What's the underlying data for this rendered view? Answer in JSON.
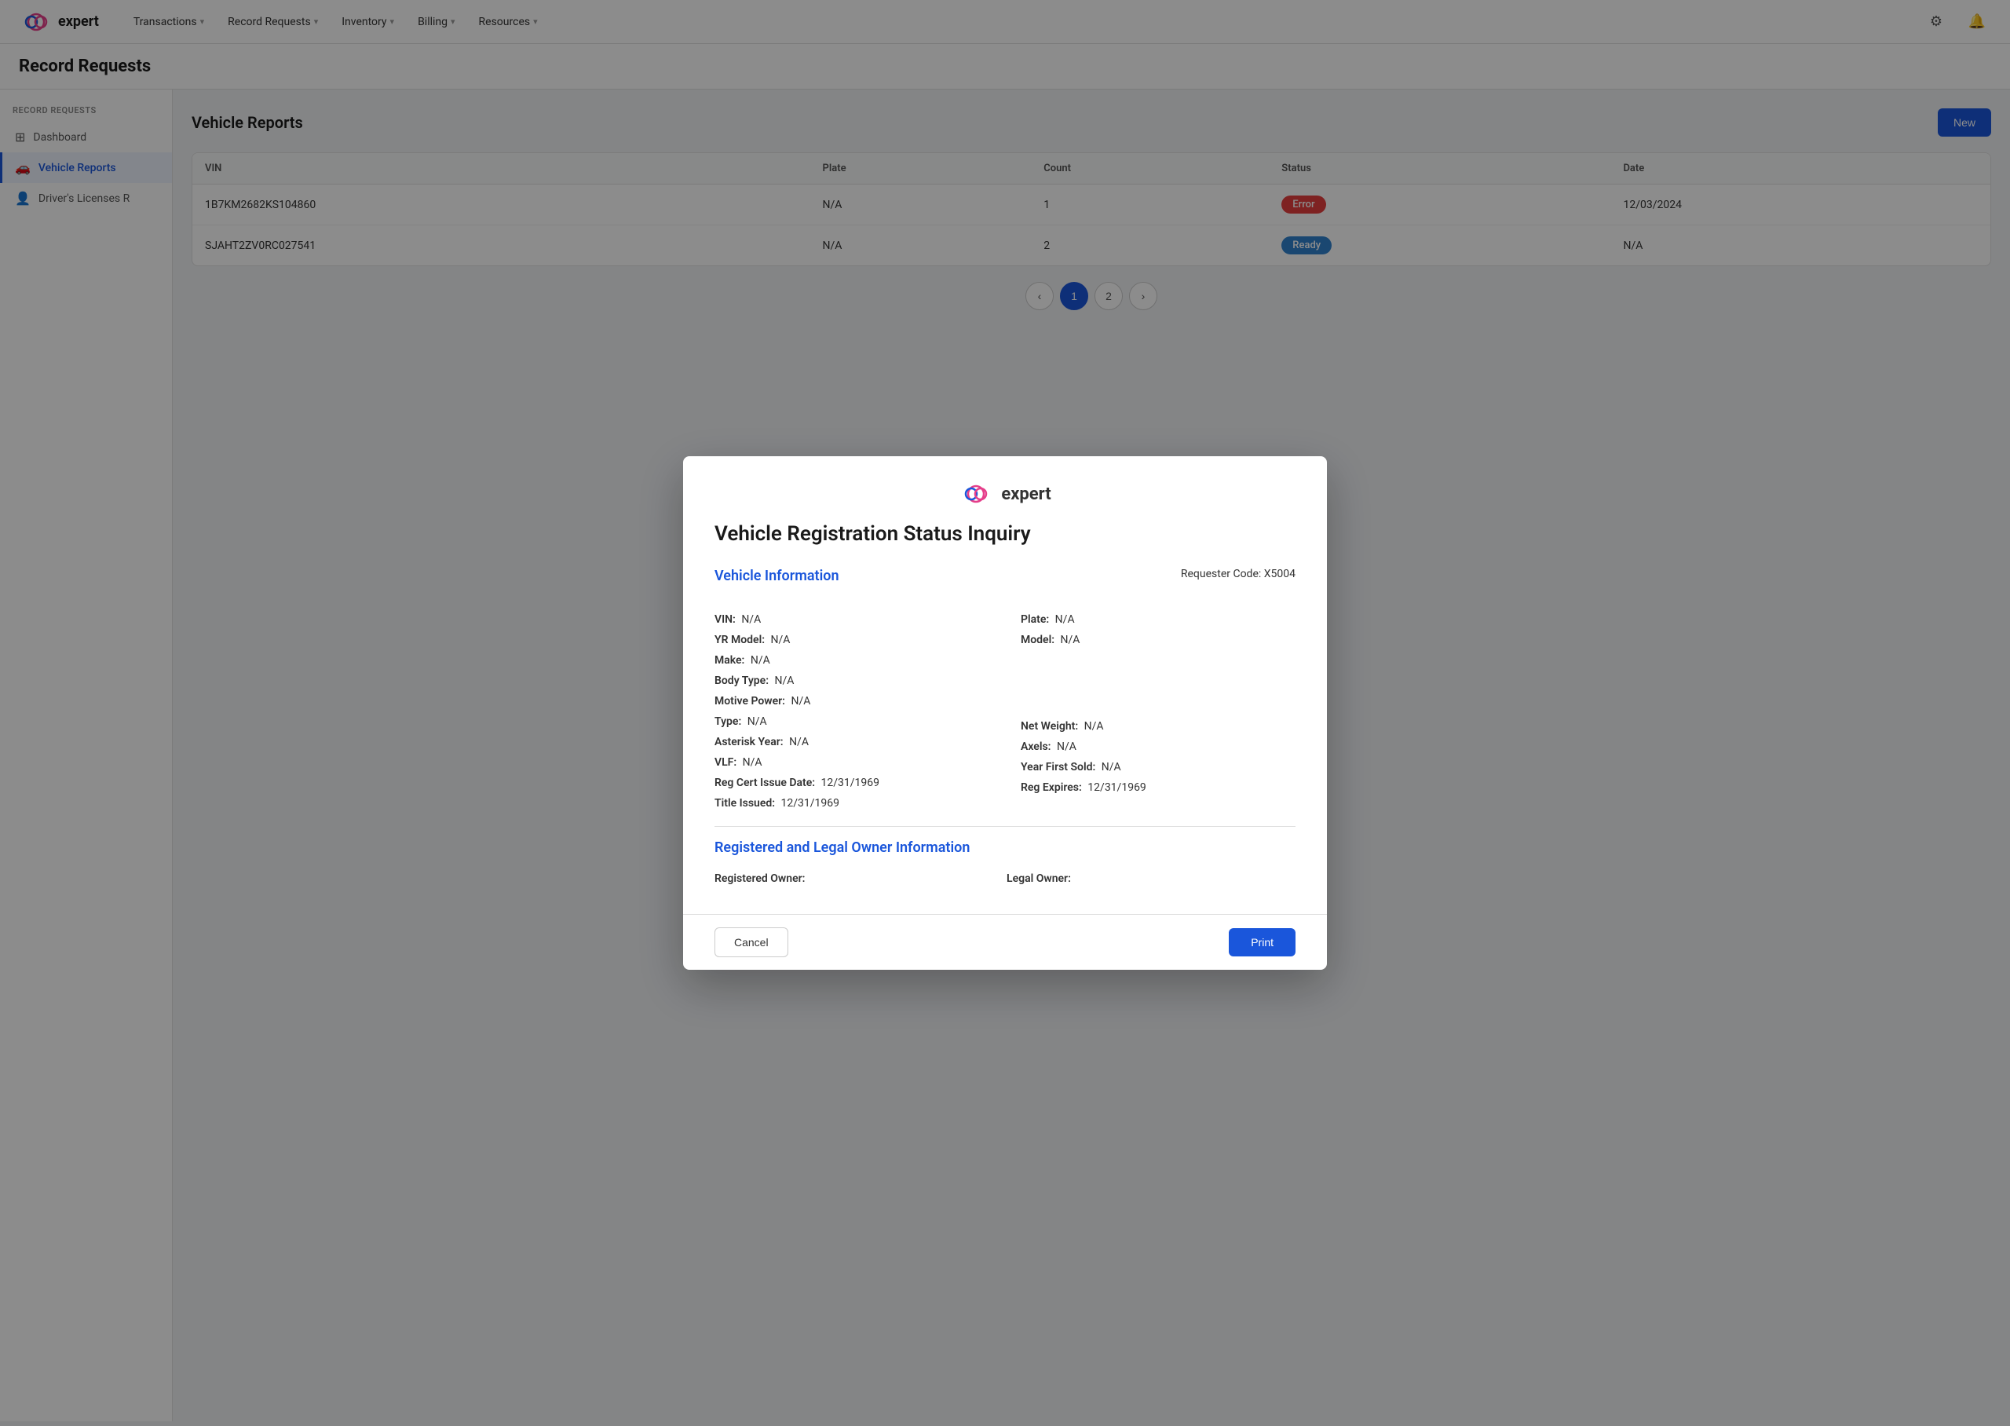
{
  "app": {
    "logo_text": "expert"
  },
  "nav": {
    "links": [
      {
        "label": "Transactions",
        "id": "transactions"
      },
      {
        "label": "Record Requests",
        "id": "record-requests"
      },
      {
        "label": "Inventory",
        "id": "inventory"
      },
      {
        "label": "Billing",
        "id": "billing"
      },
      {
        "label": "Resources",
        "id": "resources"
      }
    ]
  },
  "page": {
    "title": "Record Requests"
  },
  "sidebar": {
    "section_label": "RECORD REQUESTS",
    "items": [
      {
        "label": "Dashboard",
        "id": "dashboard",
        "active": false
      },
      {
        "label": "Vehicle Reports",
        "id": "vehicle-reports",
        "active": true
      },
      {
        "label": "Driver's Licenses R",
        "id": "drivers-licenses",
        "active": false
      }
    ]
  },
  "content": {
    "title": "Vehicle Reports",
    "new_button": "New",
    "columns": [
      "VIN",
      "Plate",
      "Count",
      "Status",
      "Date"
    ]
  },
  "table": {
    "rows": [
      {
        "vin": "1B7KM2682KS104860",
        "plate": "N/A",
        "count": "1",
        "status": "Error",
        "status_type": "error",
        "date": "12/03/2024"
      },
      {
        "vin": "SJAHT2ZV0RC027541",
        "plate": "N/A",
        "count": "2",
        "status": "Ready",
        "status_type": "ready",
        "date": "N/A"
      }
    ]
  },
  "pagination": {
    "prev_label": "‹",
    "next_label": "›",
    "pages": [
      "1",
      "2"
    ],
    "current": "1"
  },
  "modal": {
    "logo_text": "expert",
    "title": "Vehicle Registration Status Inquiry",
    "requester_label": "Requester Code:",
    "requester_value": "X5004",
    "vehicle_section": "Vehicle Information",
    "owner_section": "Registered and Legal Owner Information",
    "fields_left": [
      {
        "label": "VIN:",
        "value": "N/A"
      },
      {
        "label": "YR Model:",
        "value": "N/A"
      },
      {
        "label": "Make:",
        "value": "N/A"
      },
      {
        "label": "Body Type:",
        "value": "N/A"
      },
      {
        "label": "Motive Power:",
        "value": "N/A"
      },
      {
        "label": "Type:",
        "value": "N/A"
      },
      {
        "label": "Asterisk Year:",
        "value": "N/A"
      },
      {
        "label": "VLF:",
        "value": "N/A"
      },
      {
        "label": "Reg Cert Issue Date:",
        "value": "12/31/1969"
      },
      {
        "label": "Title Issued:",
        "value": "12/31/1969"
      }
    ],
    "fields_right": [
      {
        "label": "Plate:",
        "value": "N/A"
      },
      {
        "label": "Model:",
        "value": "N/A"
      },
      {
        "label": "",
        "value": ""
      },
      {
        "label": "",
        "value": ""
      },
      {
        "label": "",
        "value": ""
      },
      {
        "label": "Net Weight:",
        "value": "N/A"
      },
      {
        "label": "Axels:",
        "value": "N/A"
      },
      {
        "label": "Year First Sold:",
        "value": "N/A"
      },
      {
        "label": "Reg Expires:",
        "value": "12/31/1969"
      },
      {
        "label": "",
        "value": ""
      }
    ],
    "owner_left_label": "Registered Owner:",
    "owner_left_value": "",
    "owner_right_label": "Legal Owner:",
    "owner_right_value": "",
    "cancel_label": "Cancel",
    "print_label": "Print"
  },
  "status": {
    "ready_label": "Ready"
  }
}
